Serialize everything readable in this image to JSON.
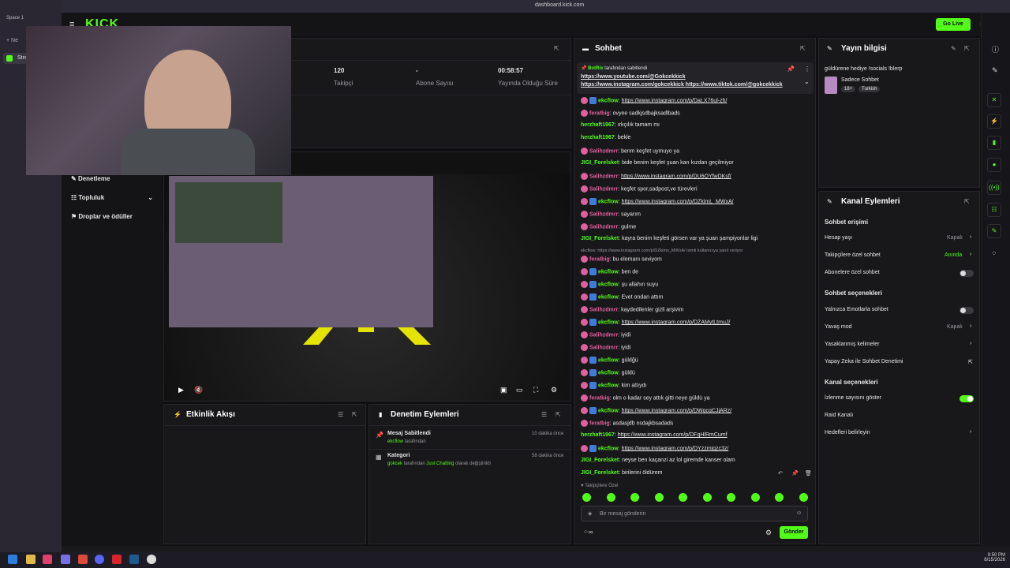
{
  "browser": {
    "url": "dashboard.kick.com",
    "space_label": "Space 1",
    "new_tab": "Ne",
    "tab_label": "Stre"
  },
  "header": {
    "go_live": "Go Live"
  },
  "stats": [
    {
      "value": "120",
      "label": "Takipçi"
    },
    {
      "value": "-",
      "label": "Abone Sayısı"
    },
    {
      "value": "00:58:57",
      "label": "Yayında Olduğu Süre"
    }
  ],
  "nav": {
    "items": [
      {
        "label": "Denetleme"
      },
      {
        "label": "Topluluk"
      },
      {
        "label": "Droplar ve ödüller"
      }
    ]
  },
  "activity": {
    "title": "Etkinlik Akışı"
  },
  "mod_actions": {
    "title": "Denetim Eylemleri",
    "items": [
      {
        "title": "Mesaj Sabitlendi",
        "user": "ekcflow",
        "detail": "tarafından",
        "time": "10 dakika önce"
      },
      {
        "title": "Kategori",
        "user": "gokcek",
        "detail": "tarafından",
        "category": "Just Chatting",
        "suffix": "olarak değiştirildi",
        "time": "58 dakika önce"
      }
    ]
  },
  "chat": {
    "title": "Sohbet",
    "pinned": {
      "user": "BotRix",
      "by": "tarafından sabitlendi",
      "line1": "https://www.youtube.com/@Gokcekkick",
      "line2": "https://www.instagram.com/gokcekkick",
      "line3": "https://www.tiktok.com/@gokcekkick"
    },
    "messages": [
      {
        "user": "ekcflow",
        "ucolor": "#53fc18",
        "badges": 2,
        "text": "https://www.instagram.com/p/DaLX76ul-zh/",
        "link": true
      },
      {
        "user": "feratbig",
        "ucolor": "#e0609e",
        "badges": 1,
        "text": "ovyee sadkjsdbajksadlbads"
      },
      {
        "user": "herzhaft1967",
        "ucolor": "#53fc18",
        "badges": 0,
        "text": "ırkçılık tamam mı"
      },
      {
        "user": "herzhaft1967",
        "ucolor": "#53fc18",
        "badges": 0,
        "text": "bekle"
      },
      {
        "user": "Salihzdmrr",
        "ucolor": "#e0609e",
        "badges": 1,
        "text": "benm keşfet uymuyo ya"
      },
      {
        "user": "JIGI_Forelsket",
        "ucolor": "#53fc18",
        "badges": 0,
        "text": "bide benim keşfet şuan karı kızdan geçilmiyor"
      },
      {
        "user": "Salihzdmrr",
        "ucolor": "#e0609e",
        "badges": 1,
        "text": "https://www.instagram.com/p/DU6QYfwDKsf/",
        "link": true
      },
      {
        "user": "Salihzdmrr",
        "ucolor": "#e0609e",
        "badges": 1,
        "text": "keşfet spor,sadpost,ve türevleri"
      },
      {
        "user": "ekcflow",
        "ucolor": "#53fc18",
        "badges": 2,
        "text": "https://www.instagram.com/p/DZkimL_MWxA/",
        "link": true
      },
      {
        "user": "Salihzdmrr",
        "ucolor": "#e0609e",
        "badges": 1,
        "text": "sayarım"
      },
      {
        "user": "Salihzdmrr",
        "ucolor": "#e0609e",
        "badges": 1,
        "text": "gulme"
      },
      {
        "user": "JIGI_Forelsket",
        "ucolor": "#53fc18",
        "badges": 0,
        "text": "kayra benim keşfeti görsen var ya şuan şampiyonlar ligi"
      },
      {
        "user": "feratbig",
        "ucolor": "#e0609e",
        "badges": 1,
        "text": "bu elemanı seviyom",
        "reply": "ekcflow: https://www.instagram.com/p/DZkims_MWxA/ isimli kullanıcıya yanıt veriyor"
      },
      {
        "user": "ekcflow",
        "ucolor": "#53fc18",
        "badges": 2,
        "text": "ben de"
      },
      {
        "user": "ekcflow",
        "ucolor": "#53fc18",
        "badges": 2,
        "text": "şu allahın suyu"
      },
      {
        "user": "ekcflow",
        "ucolor": "#53fc18",
        "badges": 2,
        "text": "Evet ondan attım"
      },
      {
        "user": "Salihzdmrr",
        "ucolor": "#e0609e",
        "badges": 1,
        "text": "kaydedilenler gizli arşivim"
      },
      {
        "user": "ekcflow",
        "ucolor": "#53fc18",
        "badges": 2,
        "text": "https://www.instagram.com/p/DZAMytLtmuJ/",
        "link": true
      },
      {
        "user": "Salihzdmrr",
        "ucolor": "#e0609e",
        "badges": 1,
        "text": "iyidi"
      },
      {
        "user": "Salihzdmrr",
        "ucolor": "#e0609e",
        "badges": 1,
        "text": "iyidi"
      },
      {
        "user": "ekcflow",
        "ucolor": "#53fc18",
        "badges": 2,
        "text": "güldğü"
      },
      {
        "user": "ekcflow",
        "ucolor": "#53fc18",
        "badges": 2,
        "text": "güldü"
      },
      {
        "user": "ekcflow",
        "ucolor": "#53fc18",
        "badges": 2,
        "text": "kim attıydı"
      },
      {
        "user": "feratbig",
        "ucolor": "#e0609e",
        "badges": 1,
        "text": "olm o kadar sey attık gitti neye güldü ya"
      },
      {
        "user": "ekcflow",
        "ucolor": "#53fc18",
        "badges": 2,
        "text": "https://www.instagram.com/p/DWgcqCJjARz/",
        "link": true
      },
      {
        "user": "feratbig",
        "ucolor": "#e0609e",
        "badges": 1,
        "text": "asdasjdb nsdajkbsadads"
      },
      {
        "user": "herzhaft1967",
        "ucolor": "#53fc18",
        "badges": 0,
        "text": "https://www.instagram.com/p/DFgHlRmCumf",
        "link": true
      },
      {
        "user": "ekcflow",
        "ucolor": "#53fc18",
        "badges": 2,
        "text": "https://www.instagram.com/p/DYzzmjgzc3z/",
        "link": true
      },
      {
        "user": "JIGI_Forelsket",
        "ucolor": "#53fc18",
        "badges": 0,
        "text": "neyse ben kaçanzi az lol giremde kanser olam"
      },
      {
        "user": "JIGI_Forelsket",
        "ucolor": "#53fc18",
        "badges": 0,
        "text": "birilerini öldürem"
      }
    ],
    "followers_only": "Takipçilere Özel",
    "input_placeholder": "Bir mesaj gönderin",
    "send": "Gönder"
  },
  "stream_info": {
    "title": "Yayın bilgisi",
    "stream_title": "güldürene hediye !socials !blerp",
    "category": "Sadece Sohbet",
    "tags": [
      "18+",
      "Turkish"
    ]
  },
  "channel_actions": {
    "title": "Kanal Eylemleri",
    "chat_access": "Sohbet erişimi",
    "account_age": {
      "label": "Hesap yaşı",
      "value": "Kapalı"
    },
    "followers_chat": {
      "label": "Takipçilere özel sohbet",
      "value": "Anında"
    },
    "subs_chat": {
      "label": "Abonelere özel sohbet"
    },
    "chat_options": "Sohbet seçenekleri",
    "emotes_only": {
      "label": "Yalnızca Emotlarla sohbet"
    },
    "slow_mode": {
      "label": "Yavaş mod",
      "value": "Kapalı"
    },
    "banned_words": {
      "label": "Yasaklanmış kelimeler"
    },
    "ai_mod": {
      "label": "Yapay Zeka ile Sohbet Denetimi"
    },
    "channel_options": "Kanal seçenekleri",
    "show_viewers": {
      "label": "İzlenme sayısını göster"
    },
    "raid": {
      "label": "Raid Kanalı"
    },
    "goals": {
      "label": "Hedefleri belirleyin"
    }
  },
  "taskbar": {
    "time": "9:50 PM",
    "date": "8/15/2026"
  }
}
